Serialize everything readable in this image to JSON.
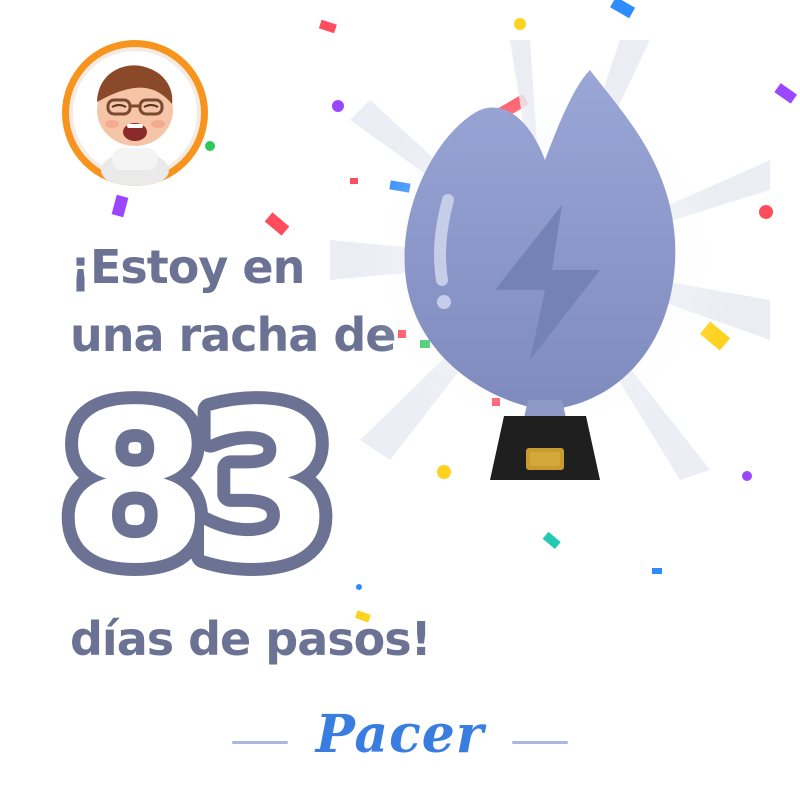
{
  "share_card": {
    "heading_line_1": "¡Estoy en",
    "heading_line_2": "una racha de",
    "streak_count": "83",
    "heading_line_3": "días de pasos!",
    "brand": "Pacer"
  },
  "colors": {
    "text": "#6b7294",
    "avatar_ring": "#f7941d",
    "trophy_flame": "#8d99c8",
    "trophy_base": "#1f1f1f",
    "trophy_plaque": "#c99a2e",
    "brand_blue": "#3a7de0"
  },
  "icons": [
    "avatar-photo",
    "flame-trophy-icon",
    "lightning-bolt-icon",
    "confetti"
  ]
}
